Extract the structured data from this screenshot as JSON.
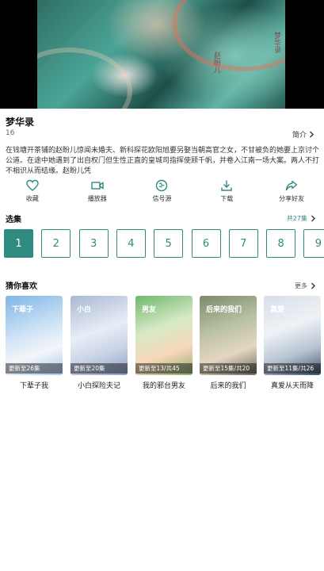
{
  "player": {
    "overlay_text_1": "梦华录",
    "overlay_text_2": "赵盼儿"
  },
  "show": {
    "title": "梦华录",
    "episode_total": "16",
    "intro_label": "简介",
    "description": "在钱塘开茶铺的赵盼儿惊闻未婚夫、新科探花欧阳旭要另娶当朝高官之女，不甘被负的她要上京讨个公道。在途中她遇到了出自权门但生性正直的皇城司指挥使顾千帆，并卷入江南一场大案。两人不打不相识从而结缘。赵盼儿凭"
  },
  "actions": [
    {
      "label": "收藏",
      "icon": "heart-icon"
    },
    {
      "label": "播放器",
      "icon": "video-player-icon"
    },
    {
      "label": "信号源",
      "icon": "signal-source-icon"
    },
    {
      "label": "下载",
      "icon": "download-icon"
    },
    {
      "label": "分享好友",
      "icon": "share-icon"
    }
  ],
  "episodes": {
    "heading": "选集",
    "total_label": "共27集",
    "items": [
      "1",
      "2",
      "3",
      "4",
      "5",
      "6",
      "7",
      "8",
      "9"
    ],
    "selected": "1"
  },
  "recommendations": {
    "heading": "猜你喜欢",
    "more_label": "更多",
    "items": [
      {
        "name": "下辈子我",
        "badge": "更新至26集",
        "cover_text": "下辈子"
      },
      {
        "name": "小白探险夫记",
        "badge": "更新至20集",
        "cover_text": "小白"
      },
      {
        "name": "我的邪台男友",
        "badge": "更新至13/共45",
        "cover_text": "男友"
      },
      {
        "name": "后来的我们",
        "badge": "更新至15集/共20",
        "cover_text": "后来的我们"
      },
      {
        "name": "真爱从天而降",
        "badge": "更新至11集/共26",
        "cover_text": "真爱"
      }
    ]
  },
  "colors": {
    "accent": "#2f8a7f"
  }
}
